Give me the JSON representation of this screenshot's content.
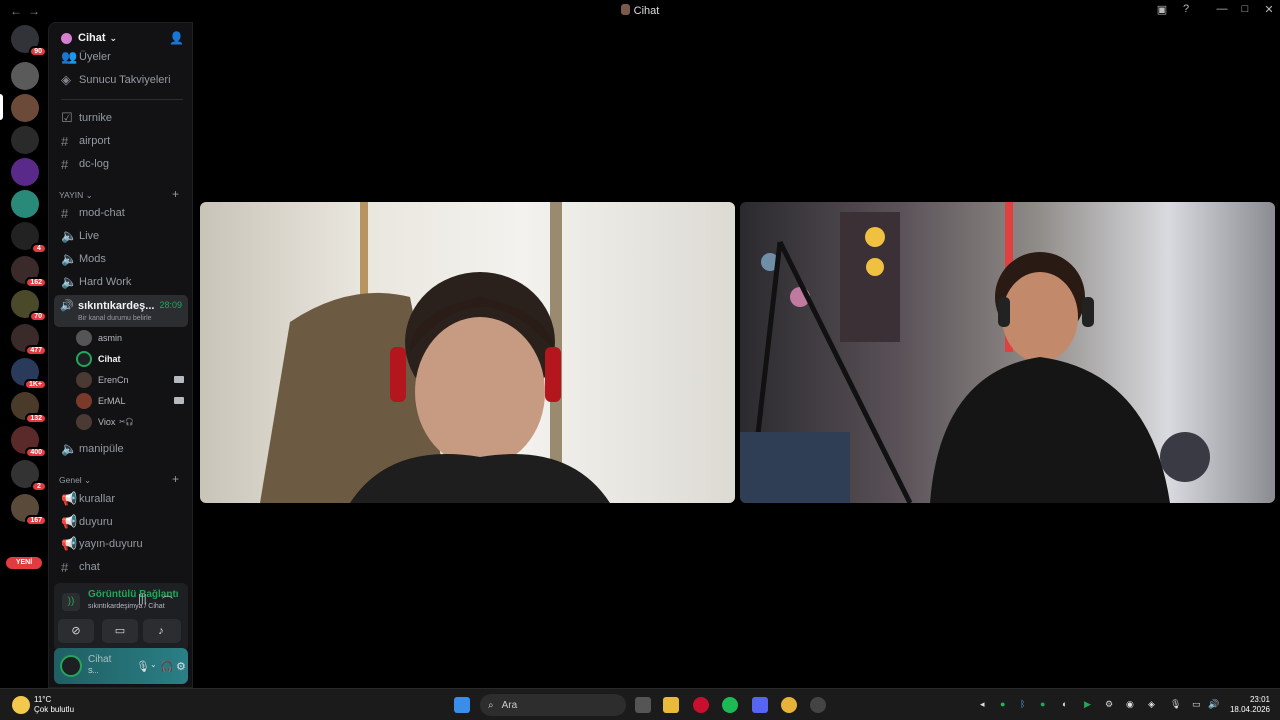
{
  "window": {
    "title": "Cihat",
    "back_icon": "arrow-left",
    "forward_icon": "arrow-right"
  },
  "guild_badges": [
    "90",
    "4",
    "162",
    "70",
    "477",
    "1K+",
    "132",
    "400",
    "2",
    "167"
  ],
  "yeni_label": "YENİ",
  "server": {
    "name": "Cihat"
  },
  "top_items": [
    "Üyeler",
    "Sunucu Takviyeleri"
  ],
  "channels_top": [
    "turnike",
    "airport",
    "dc-log"
  ],
  "category_yayin": "YAYIN",
  "channels_yayin": [
    "mod-chat",
    "Live",
    "Mods",
    "Hard Work"
  ],
  "active_voice": {
    "name": "sıkıntıkardeş...",
    "time": "28:09",
    "status": "Bir kanal durumu belirle"
  },
  "voice_users": [
    {
      "name": "asmin"
    },
    {
      "name": "Cihat"
    },
    {
      "name": "ErenCn"
    },
    {
      "name": "ErMAL"
    },
    {
      "name": "Viox"
    }
  ],
  "channel_manipule": "manipüle",
  "category_genel": "Genel",
  "channels_genel": [
    "kurallar",
    "duyuru",
    "yayın-duyuru",
    "chat"
  ],
  "connection": {
    "title": "Görüntülü Bağlantı",
    "subtitle": "sıkıntıkardeşimya / Cihat"
  },
  "user_panel": {
    "name": "Cihat",
    "status": "S..."
  },
  "taskbar": {
    "temp": "11°C",
    "weather": "Çok bulutlu",
    "search": "Ara",
    "time": "23:01",
    "date": "18.04.2026"
  },
  "colors": {
    "accent_green": "#23a55a",
    "badge_red": "#e23b40"
  }
}
